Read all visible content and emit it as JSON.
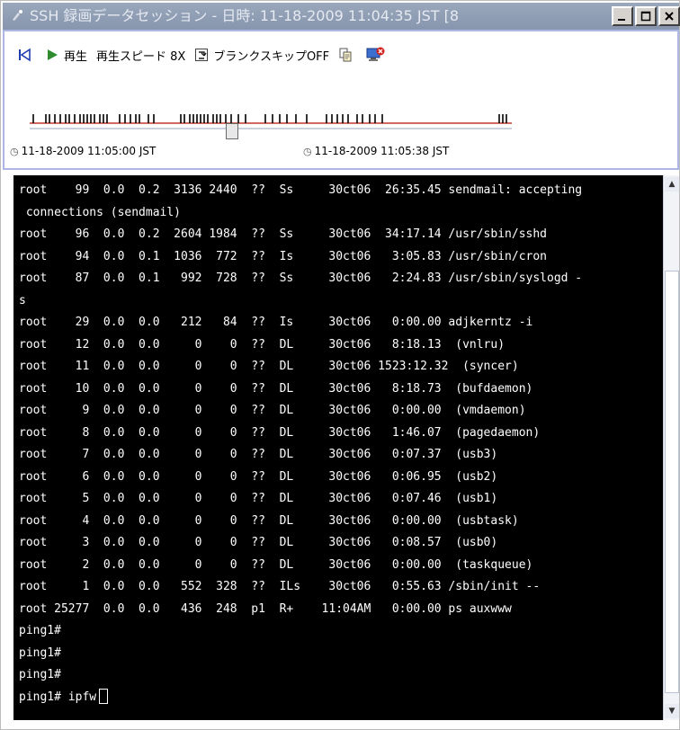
{
  "window": {
    "title": "SSH 録画データセッション - 日時: 11-18-2009 11:04:35 JST [8"
  },
  "player": {
    "play_label": "再生",
    "speed_label": "再生スピード 8X",
    "blank_skip_label": "ブランクスキップOFF",
    "start_time": "11-18-2009 11:05:00 JST",
    "end_time": "11-18-2009 11:05:38 JST",
    "accent_color": "#c0392b"
  },
  "terminal": {
    "lines": [
      "root    99  0.0  0.2  3136 2440  ??  Ss     30ct06  26:35.45 sendmail: accepting",
      " connections (sendmail)",
      "root    96  0.0  0.2  2604 1984  ??  Ss     30ct06  34:17.14 /usr/sbin/sshd",
      "root    94  0.0  0.1  1036  772  ??  Is     30ct06   3:05.83 /usr/sbin/cron",
      "root    87  0.0  0.1   992  728  ??  Ss     30ct06   2:24.83 /usr/sbin/syslogd -",
      "s",
      "root    29  0.0  0.0   212   84  ??  Is     30ct06   0:00.00 adjkerntz -i",
      "root    12  0.0  0.0     0    0  ??  DL     30ct06   8:18.13  (vnlru)",
      "root    11  0.0  0.0     0    0  ??  DL     30ct06 1523:12.32  (syncer)",
      "root    10  0.0  0.0     0    0  ??  DL     30ct06   8:18.73  (bufdaemon)",
      "root     9  0.0  0.0     0    0  ??  DL     30ct06   0:00.00  (vmdaemon)",
      "root     8  0.0  0.0     0    0  ??  DL     30ct06   1:46.07  (pagedaemon)",
      "root     7  0.0  0.0     0    0  ??  DL     30ct06   0:07.37  (usb3)",
      "root     6  0.0  0.0     0    0  ??  DL     30ct06   0:06.95  (usb2)",
      "root     5  0.0  0.0     0    0  ??  DL     30ct06   0:07.46  (usb1)",
      "root     4  0.0  0.0     0    0  ??  DL     30ct06   0:00.00  (usbtask)",
      "root     3  0.0  0.0     0    0  ??  DL     30ct06   0:08.57  (usb0)",
      "root     2  0.0  0.0     0    0  ??  DL     30ct06   0:00.00  (taskqueue)",
      "root     1  0.0  0.0   552  328  ??  ILs    30ct06   0:55.63 /sbin/init --",
      "root 25277  0.0  0.0   436  248  p1  R+    11:04AM   0:00.00 ps auxwww",
      "ping1#",
      "ping1#",
      "ping1#",
      "ping1# ipfw"
    ]
  }
}
